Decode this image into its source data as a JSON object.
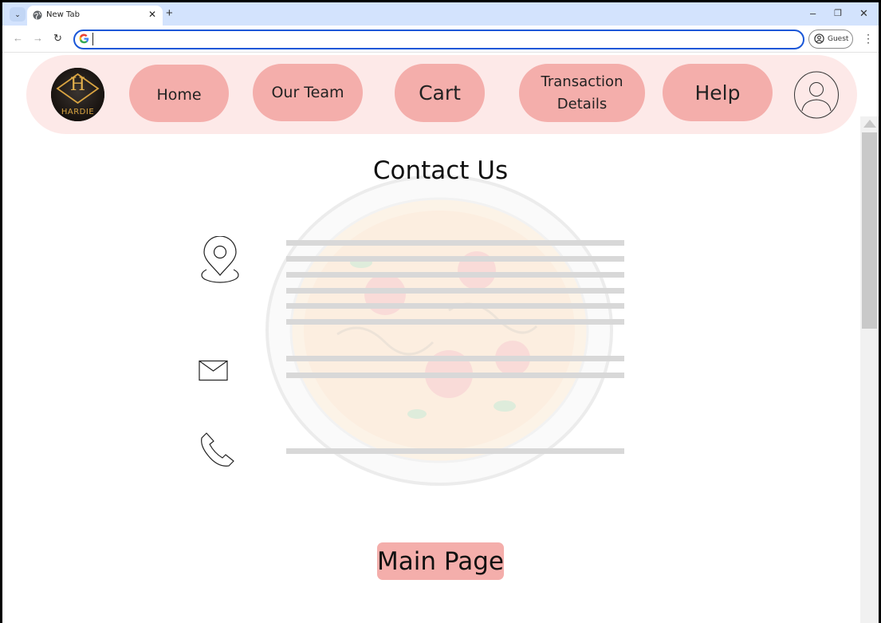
{
  "browser": {
    "tab_title": "New Tab",
    "new_tab_symbol": "+",
    "tab_close_symbol": "✕",
    "tab_search_symbol": "⌄",
    "omnibox_value": "",
    "guest_label": "Guest",
    "controls": {
      "minimize": "–",
      "restore": "❐",
      "close": "✕"
    },
    "nav": {
      "back": "←",
      "forward": "→",
      "reload": "↻"
    },
    "menu_symbol": "⋮"
  },
  "navbar": {
    "logo_letter": "H",
    "logo_text": "HARDIE",
    "items": [
      {
        "label": "Home"
      },
      {
        "label": "Our Team"
      },
      {
        "label": "Cart"
      },
      {
        "label": "Transaction Details"
      },
      {
        "label": "Help"
      }
    ]
  },
  "contact": {
    "title": "Contact Us",
    "icons": [
      "location-pin-icon",
      "envelope-icon",
      "phone-icon"
    ]
  },
  "main_button": {
    "label": "Main Page"
  },
  "colors": {
    "navbar_bg": "#fde9e8",
    "pill_bg": "#f4aeab",
    "placeholder_line": "#d8d8d8",
    "browser_chrome": "#d3e3fd"
  }
}
